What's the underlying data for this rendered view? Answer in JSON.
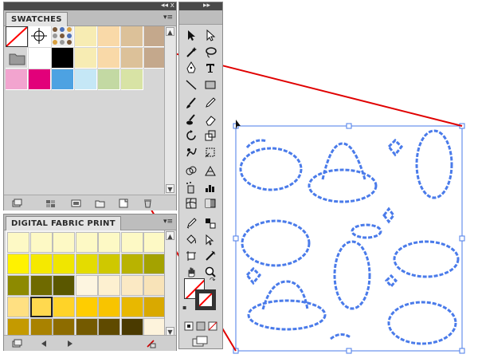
{
  "swatches_panel": {
    "title": "SWATCHES",
    "row1": [
      "#ffffff",
      "#ffffff",
      "#000000",
      "#f7ecb3",
      "#f9d9a8",
      "#dcc199",
      "#c4a88c"
    ],
    "row2": [
      "#f2a4cf",
      "#e2007a",
      "#4da2e2",
      "#c5e7f6",
      "#c3d9a3",
      "#d8e3a5"
    ],
    "pattern_colors": [
      "#7c5a3a",
      "#4c70b8",
      "#d8a040",
      "#999999"
    ]
  },
  "fabric_panel": {
    "title": "DIGITAL FABRIC PRINT",
    "rows": [
      [
        "#fdf9c5",
        "#fdf9c5",
        "#fdf9c5",
        "#fdf9c5",
        "#fdf9c5",
        "#fdf9c5",
        "#fdf9c5"
      ],
      [
        "#fff200",
        "#f5e900",
        "#f0e600",
        "#e4dc00",
        "#cfc800",
        "#b9b300",
        "#a4a200"
      ],
      [
        "#8d8a00",
        "#6f6a00",
        "#5a5700",
        "#fdf5e0",
        "#fdf0d0",
        "#fbe9c4",
        "#f8e3b8"
      ],
      [
        "#ffe082",
        "#ffd94f",
        "#ffd328",
        "#ffcd00",
        "#f8c400",
        "#e8b800",
        "#d9a900"
      ],
      [
        "#c49a00",
        "#a98200",
        "#8d6c00",
        "#745a00",
        "#5f4a00",
        "#4a3a00",
        "#fdf3dc"
      ]
    ]
  },
  "fill_stroke": {
    "fill_color": "#ffffff",
    "stroke_color": "#ffffff",
    "none_slash_color": "#ff0000"
  },
  "artwork": {
    "pattern_color": "#4a7bea",
    "guide_line_color": "#e00000",
    "selection_color": "#4a7bea"
  },
  "toolbox": {
    "tools": [
      "selection-tool",
      "direct-selection-tool",
      "magic-wand-tool",
      "lasso-tool",
      "pen-tool",
      "type-tool",
      "line-tool",
      "rectangle-tool",
      "paintbrush-tool",
      "pencil-tool",
      "blob-brush-tool",
      "eraser-tool",
      "rotate-tool",
      "scale-tool",
      "warp-tool",
      "free-transform-tool",
      "shape-builder-tool",
      "perspective-grid-tool",
      "symbol-sprayer-tool",
      "graph-tool",
      "mesh-tool",
      "gradient-tool",
      "eyedropper-tool",
      "blend-tool",
      "live-paint-bucket-tool",
      "live-paint-selection-tool",
      "artboard-tool",
      "slice-tool",
      "hand-tool",
      "zoom-tool"
    ]
  }
}
